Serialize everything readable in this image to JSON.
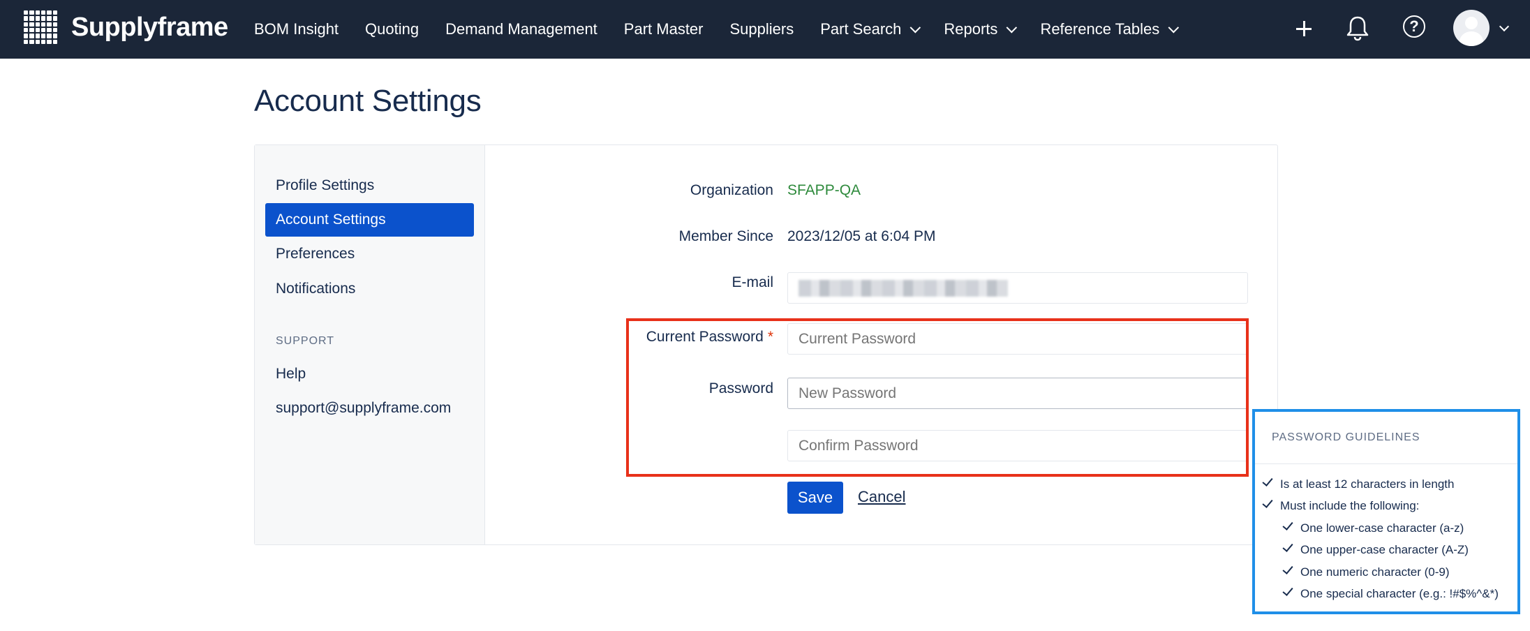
{
  "brand": {
    "name": "Supplyframe"
  },
  "nav": {
    "items": [
      {
        "label": "BOM Insight",
        "dropdown": false
      },
      {
        "label": "Quoting",
        "dropdown": false
      },
      {
        "label": "Demand Management",
        "dropdown": false
      },
      {
        "label": "Part Master",
        "dropdown": false
      },
      {
        "label": "Suppliers",
        "dropdown": false
      },
      {
        "label": "Part Search",
        "dropdown": true
      },
      {
        "label": "Reports",
        "dropdown": true
      },
      {
        "label": "Reference Tables",
        "dropdown": true
      }
    ],
    "help_glyph": "?",
    "icons": [
      "plus-icon",
      "bell-icon",
      "help-icon",
      "avatar"
    ]
  },
  "page": {
    "title": "Account Settings"
  },
  "sidebar": {
    "items": [
      {
        "label": "Profile Settings"
      },
      {
        "label": "Account Settings",
        "active": true
      },
      {
        "label": "Preferences"
      },
      {
        "label": "Notifications"
      }
    ],
    "support_heading": "SUPPORT",
    "support_items": [
      {
        "label": "Help"
      },
      {
        "label": "support@supplyframe.com"
      }
    ]
  },
  "form": {
    "organization_label": "Organization",
    "organization_value": "SFAPP-QA",
    "member_since_label": "Member Since",
    "member_since_value": "2023/12/05 at 6:04 PM",
    "email_label": "E-mail",
    "current_password_label": "Current Password",
    "required_marker": "*",
    "current_password_placeholder": "Current Password",
    "password_label": "Password",
    "new_password_placeholder": "New Password",
    "confirm_password_placeholder": "Confirm Password",
    "save_label": "Save",
    "cancel_label": "Cancel"
  },
  "guidelines": {
    "title": "PASSWORD GUIDELINES",
    "items": [
      "Is at least 12 characters in length",
      "Must include the following:",
      "One lower-case character (a-z)",
      "One upper-case character (A-Z)",
      "One numeric character (0-9)",
      "One special character (e.g.: !#$%^&*)"
    ]
  },
  "colors": {
    "nav_bg": "#1b2638",
    "accent": "#0b52cc",
    "org_green": "#2e8a3c",
    "highlight_red": "#e8311a",
    "highlight_blue": "#1f8fe8"
  }
}
